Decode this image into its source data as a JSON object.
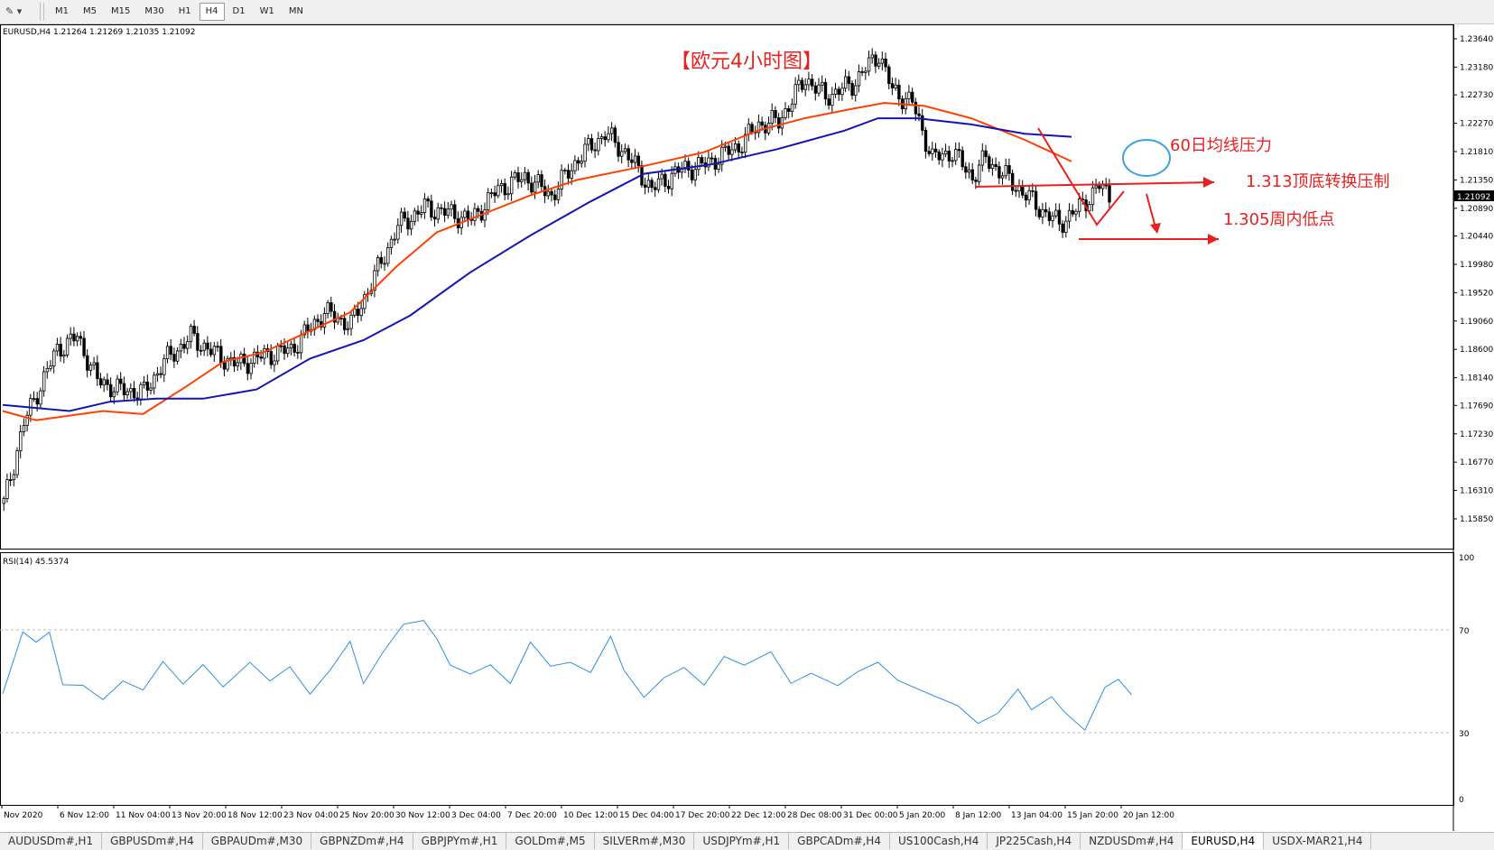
{
  "toolbar": {
    "tool_icon": "arrow-cursor-icon",
    "timeframes": [
      "M1",
      "M5",
      "M15",
      "M30",
      "H1",
      "H4",
      "D1",
      "W1",
      "MN"
    ],
    "active_timeframe": "H4"
  },
  "chart": {
    "info_line": "EURUSD,H4  1.21264 1.21269 1.21035 1.21092",
    "title_annotation": "【欧元4小时图】",
    "current_price": "1.21092",
    "price_ticks": [
      "1.23640",
      "1.23180",
      "1.22730",
      "1.22270",
      "1.21810",
      "1.21350",
      "1.20890",
      "1.20440",
      "1.19980",
      "1.19520",
      "1.19060",
      "1.18600",
      "1.18140",
      "1.17690",
      "1.17230",
      "1.16770",
      "1.16310",
      "1.15850"
    ],
    "annotations": {
      "ma_pressure": "60日均线压力",
      "top_bottom_switch": "1.313顶底转换压制",
      "weekly_low": "1.305周内低点"
    },
    "colors": {
      "bull_candle": "#000000",
      "ma_fast": "#ff4000",
      "ma_slow": "#1414b4",
      "annotation": "#e82020",
      "circle": "#3aa0e0",
      "rsi_line": "#2f8fe8"
    },
    "date_labels": [
      "Nov 2020",
      "6 Nov 12:00",
      "11 Nov 04:00",
      "13 Nov 20:00",
      "18 Nov 12:00",
      "23 Nov 04:00",
      "25 Nov 20:00",
      "30 Nov 12:00",
      "3 Dec 04:00",
      "7 Dec 20:00",
      "10 Dec 12:00",
      "15 Dec 04:00",
      "17 Dec 20:00",
      "22 Dec 12:00",
      "28 Dec 08:00",
      "31 Dec 00:00",
      "5 Jan 20:00",
      "8 Jan 12:00",
      "13 Jan 04:00",
      "15 Jan 20:00",
      "20 Jan 12:00"
    ]
  },
  "rsi": {
    "label": "RSI(14) 45.5374",
    "levels": [
      "100",
      "70",
      "30",
      "0"
    ]
  },
  "tabs": [
    "AUDUSDm#,H1",
    "GBPUSDm#,H4",
    "GBPAUDm#,M30",
    "GBPNZDm#,H4",
    "GBPJPYm#,H1",
    "GOLDm#,M5",
    "SILVERm#,M30",
    "USDJPYm#,H1",
    "GBPCADm#,H4",
    "US100Cash,H4",
    "JP225Cash,H4",
    "NZDUSDm#,H4",
    "EURUSD,H4",
    "USDX-MAR21,H4"
  ],
  "active_tab": "EURUSD,H4",
  "chart_data": {
    "type": "candlestick",
    "symbol": "EURUSD",
    "timeframe": "H4",
    "ylim": [
      1.1585,
      1.2364
    ],
    "price_path": [
      [
        0,
        1.161
      ],
      [
        6,
        1.174
      ],
      [
        10,
        1.179
      ],
      [
        16,
        1.186
      ],
      [
        22,
        1.188
      ],
      [
        28,
        1.181
      ],
      [
        34,
        1.1795
      ],
      [
        42,
        1.179
      ],
      [
        48,
        1.184
      ],
      [
        56,
        1.188
      ],
      [
        64,
        1.185
      ],
      [
        70,
        1.1835
      ],
      [
        78,
        1.185
      ],
      [
        86,
        1.186
      ],
      [
        96,
        1.192
      ],
      [
        104,
        1.19
      ],
      [
        112,
        1.199
      ],
      [
        118,
        1.206
      ],
      [
        126,
        1.209
      ],
      [
        134,
        1.208
      ],
      [
        140,
        1.207
      ],
      [
        148,
        1.212
      ],
      [
        156,
        1.214
      ],
      [
        164,
        1.211
      ],
      [
        172,
        1.217
      ],
      [
        180,
        1.221
      ],
      [
        186,
        1.218
      ],
      [
        194,
        1.212
      ],
      [
        202,
        1.215
      ],
      [
        210,
        1.216
      ],
      [
        220,
        1.219
      ],
      [
        226,
        1.2225
      ],
      [
        232,
        1.223
      ],
      [
        240,
        1.23
      ],
      [
        246,
        1.227
      ],
      [
        254,
        1.229
      ],
      [
        262,
        1.234
      ],
      [
        266,
        1.228
      ],
      [
        272,
        1.226
      ],
      [
        278,
        1.217
      ],
      [
        284,
        1.218
      ],
      [
        290,
        1.214
      ],
      [
        294,
        1.217
      ],
      [
        300,
        1.214
      ],
      [
        306,
        1.211
      ],
      [
        312,
        1.208
      ],
      [
        316,
        1.2064
      ],
      [
        322,
        1.209
      ],
      [
        328,
        1.2125
      ],
      [
        331,
        1.211
      ]
    ],
    "ma_fast": [
      [
        0,
        1.176
      ],
      [
        10,
        1.1745
      ],
      [
        30,
        1.176
      ],
      [
        42,
        1.1755
      ],
      [
        55,
        1.18
      ],
      [
        66,
        1.184
      ],
      [
        78,
        1.1855
      ],
      [
        92,
        1.189
      ],
      [
        104,
        1.192
      ],
      [
        118,
        1.1995
      ],
      [
        130,
        1.205
      ],
      [
        144,
        1.208
      ],
      [
        158,
        1.211
      ],
      [
        172,
        1.2135
      ],
      [
        190,
        1.2155
      ],
      [
        210,
        1.218
      ],
      [
        226,
        1.2215
      ],
      [
        240,
        1.2235
      ],
      [
        254,
        1.225
      ],
      [
        264,
        1.226
      ],
      [
        276,
        1.2255
      ],
      [
        290,
        1.2235
      ],
      [
        306,
        1.22
      ],
      [
        320,
        1.2165
      ]
    ],
    "ma_slow": [
      [
        0,
        1.177
      ],
      [
        20,
        1.176
      ],
      [
        32,
        1.1775
      ],
      [
        46,
        1.178
      ],
      [
        60,
        1.178
      ],
      [
        76,
        1.1795
      ],
      [
        92,
        1.1845
      ],
      [
        108,
        1.1875
      ],
      [
        122,
        1.1915
      ],
      [
        140,
        1.1985
      ],
      [
        158,
        1.2045
      ],
      [
        176,
        1.21
      ],
      [
        192,
        1.2145
      ],
      [
        212,
        1.216
      ],
      [
        232,
        1.2185
      ],
      [
        252,
        1.2215
      ],
      [
        262,
        1.2235
      ],
      [
        274,
        1.2235
      ],
      [
        290,
        1.2225
      ],
      [
        306,
        1.221
      ],
      [
        320,
        1.2205
      ]
    ],
    "rsi_path": [
      [
        0,
        45
      ],
      [
        6,
        72
      ],
      [
        10,
        68
      ],
      [
        14,
        70
      ],
      [
        18,
        50
      ],
      [
        24,
        50
      ],
      [
        30,
        44
      ],
      [
        36,
        52
      ],
      [
        42,
        48
      ],
      [
        48,
        60
      ],
      [
        54,
        50
      ],
      [
        60,
        58
      ],
      [
        66,
        48
      ],
      [
        74,
        60
      ],
      [
        80,
        52
      ],
      [
        86,
        58
      ],
      [
        92,
        46
      ],
      [
        98,
        56
      ],
      [
        104,
        68
      ],
      [
        108,
        48
      ],
      [
        114,
        62
      ],
      [
        120,
        74
      ],
      [
        126,
        76
      ],
      [
        130,
        70
      ],
      [
        134,
        56
      ],
      [
        140,
        52
      ],
      [
        146,
        56
      ],
      [
        152,
        48
      ],
      [
        158,
        66
      ],
      [
        164,
        56
      ],
      [
        170,
        58
      ],
      [
        176,
        54
      ],
      [
        182,
        70
      ],
      [
        186,
        56
      ],
      [
        192,
        44
      ],
      [
        198,
        52
      ],
      [
        204,
        56
      ],
      [
        210,
        48
      ],
      [
        216,
        60
      ],
      [
        222,
        56
      ],
      [
        230,
        64
      ],
      [
        236,
        50
      ],
      [
        242,
        54
      ],
      [
        250,
        50
      ],
      [
        256,
        56
      ],
      [
        262,
        60
      ],
      [
        268,
        52
      ],
      [
        274,
        48
      ],
      [
        280,
        44
      ],
      [
        286,
        40
      ],
      [
        292,
        32
      ],
      [
        298,
        36
      ],
      [
        304,
        46
      ],
      [
        308,
        38
      ],
      [
        314,
        44
      ],
      [
        318,
        38
      ],
      [
        324,
        30
      ],
      [
        330,
        48
      ],
      [
        334,
        50
      ],
      [
        338,
        46
      ]
    ]
  }
}
